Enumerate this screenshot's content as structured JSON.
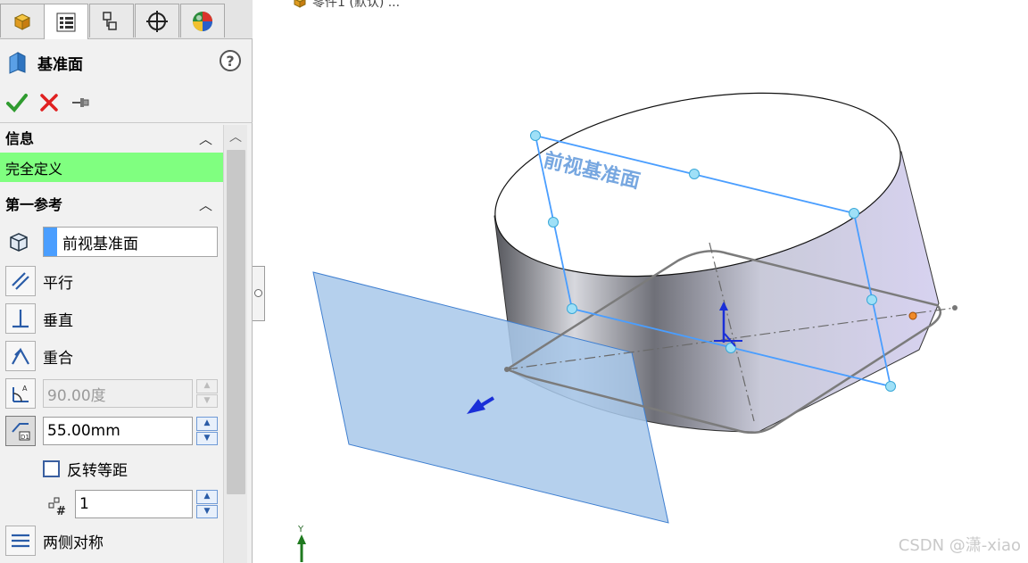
{
  "window": {
    "breadcrumb": "零件1 (默认) ...",
    "watermark": "CSDN @潇-xiao"
  },
  "tabs": [
    {
      "icon": "feature-manager-icon",
      "active": false
    },
    {
      "icon": "property-manager-icon",
      "active": true
    },
    {
      "icon": "configuration-manager-icon",
      "active": false
    },
    {
      "icon": "dimxpert-icon",
      "active": false
    },
    {
      "icon": "display-manager-icon",
      "active": false
    }
  ],
  "property_manager": {
    "title": "基准面",
    "help_label": "?"
  },
  "info_section": {
    "header": "信息",
    "status": "完全定义",
    "status_color": "#80ff80"
  },
  "first_reference": {
    "header": "第一参考",
    "reference_value": "前视基准面",
    "options": {
      "parallel": "平行",
      "perpendicular": "垂直",
      "coincident": "重合"
    },
    "angle_value": "90.00度",
    "distance_value": "55.00mm",
    "flip_offset_label": "反转等距",
    "instances_value": "1",
    "mid_plane_label": "两侧对称"
  },
  "scene": {
    "plane_label": "前视基准面",
    "triad_axis": "Y",
    "plane_color": "#a8c8ea",
    "accent_color": "#4a9eff"
  }
}
